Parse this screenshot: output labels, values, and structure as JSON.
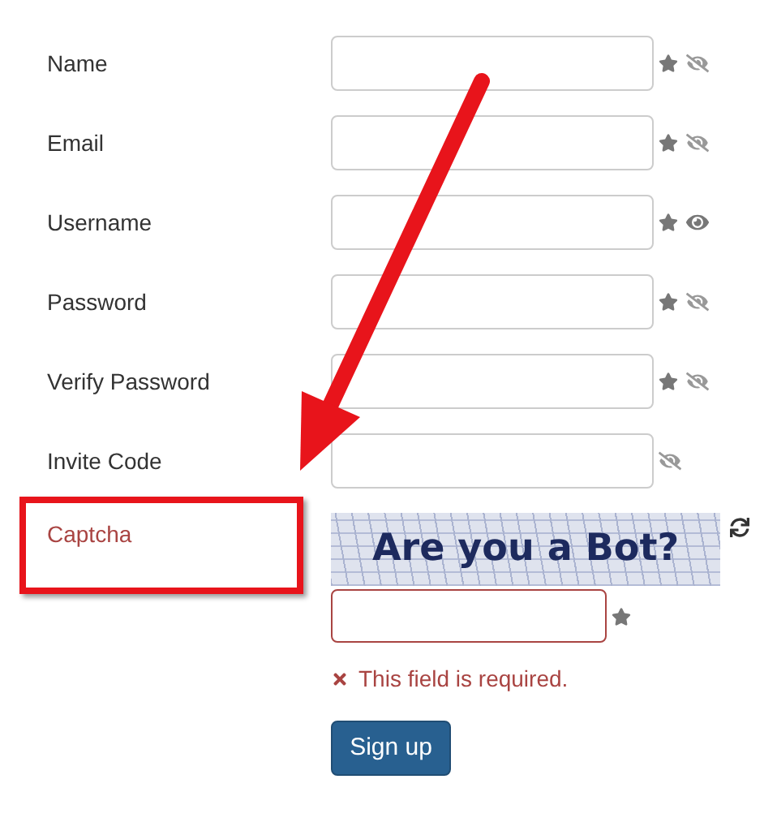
{
  "fields": [
    {
      "label": "Name",
      "required": true,
      "visible": false,
      "error": false
    },
    {
      "label": "Email",
      "required": true,
      "visible": false,
      "error": false
    },
    {
      "label": "Username",
      "required": true,
      "visible": true,
      "error": false
    },
    {
      "label": "Password",
      "required": true,
      "visible": false,
      "error": false
    },
    {
      "label": "Verify Password",
      "required": true,
      "visible": false,
      "error": false
    },
    {
      "label": "Invite Code",
      "required": false,
      "visible": false,
      "error": false
    }
  ],
  "captcha": {
    "label": "Captcha",
    "image_text": "Are you a Bot?",
    "required": true,
    "error": true,
    "error_message": "This field is required."
  },
  "button": "Sign up"
}
